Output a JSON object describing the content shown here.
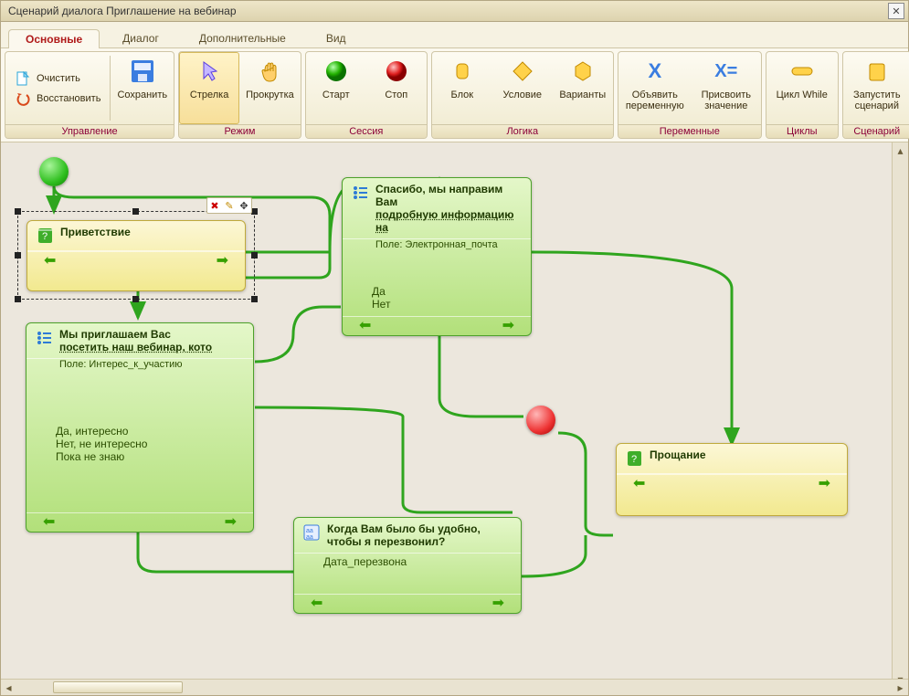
{
  "window": {
    "title": "Сценарий диалога Приглашение на вебинар"
  },
  "tabs": [
    {
      "label": "Основные",
      "active": true
    },
    {
      "label": "Диалог",
      "active": false
    },
    {
      "label": "Дополнительные",
      "active": false
    },
    {
      "label": "Вид",
      "active": false
    }
  ],
  "ribbon": {
    "groups": [
      {
        "label": "Управление",
        "clear": "Очистить",
        "restore": "Восстановить",
        "save": "Сохранить"
      },
      {
        "label": "Режим",
        "arrow": "Стрелка",
        "scroll": "Прокрутка"
      },
      {
        "label": "Сессия",
        "start": "Старт",
        "stop": "Стоп"
      },
      {
        "label": "Логика",
        "block": "Блок",
        "cond": "Условие",
        "variants": "Варианты"
      },
      {
        "label": "Переменные",
        "declare_l1": "Объявить",
        "declare_l2": "переменную",
        "assign_l1": "Присвоить",
        "assign_l2": "значение"
      },
      {
        "label": "Циклы",
        "while": "Цикл While"
      },
      {
        "label": "Сценарий",
        "run_l1": "Запустить",
        "run_l2": "сценарий"
      }
    ]
  },
  "nodes": {
    "greeting": {
      "title": "Приветствие"
    },
    "invite": {
      "title_l1": "Мы приглашаем Вас",
      "title_l2": "посетить наш вебинар, кото",
      "field": "Поле: Интерес_к_участию",
      "opt1": "Да, интересно",
      "opt2": "Нет, не интересно",
      "opt3": "Пока не знаю"
    },
    "thanks": {
      "title_l1": "Спасибо, мы направим Вам",
      "title_l2": "подробную информацию на",
      "field": "Поле: Электронная_почта",
      "opt1": "Да",
      "opt2": "Нет"
    },
    "callback": {
      "title_l1": "Когда Вам было бы удобно,",
      "title_l2": "чтобы я перезвонил?",
      "body": "Дата_перезвона"
    },
    "farewell": {
      "title": "Прощание"
    }
  },
  "colors": {
    "wire": "#2fa51e"
  }
}
